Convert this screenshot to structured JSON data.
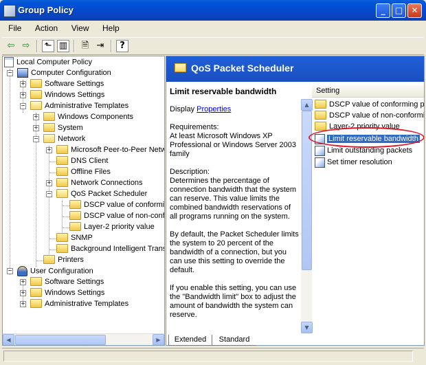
{
  "window": {
    "title": "Group Policy",
    "min_label": "_",
    "max_label": "□",
    "close_label": "✕"
  },
  "menu": [
    "File",
    "Action",
    "View",
    "Help"
  ],
  "toolbar": {
    "back": "⇦",
    "forward": "⇨",
    "up": "⬑",
    "tree": "▥",
    "properties": "🗎",
    "export": "⇥",
    "help": "?"
  },
  "tree": {
    "root": "Local Computer Policy",
    "computer_config": "Computer Configuration",
    "software_settings": "Software Settings",
    "windows_settings": "Windows Settings",
    "admin_templates": "Administrative Templates",
    "windows_components": "Windows Components",
    "system": "System",
    "network": "Network",
    "peer": "Microsoft Peer-to-Peer Netw",
    "dns": "DNS Client",
    "offline": "Offline Files",
    "netconn": "Network Connections",
    "qos": "QoS Packet Scheduler",
    "dscp1": "DSCP value of conformin",
    "dscp2": "DSCP value of non-conf",
    "layer2": "Layer-2 priority value",
    "snmp": "SNMP",
    "bits": "Background Intelligent Trans",
    "printers": "Printers",
    "user_config": "User Configuration",
    "u_software": "Software Settings",
    "u_windows": "Windows Settings",
    "u_admin": "Administrative Templates"
  },
  "details": {
    "header": "QoS Packet Scheduler",
    "title": "Limit reservable bandwidth",
    "display": "Display",
    "properties_link": "Properties",
    "requirements": "Requirements:\nAt least Microsoft Windows XP Professional or Windows Server 2003 family",
    "description": "Description:\nDetermines the percentage of connection bandwidth that the system can reserve. This value limits the combined bandwidth reservations of all programs running on the system.",
    "default": "By default, the Packet Scheduler limits the system to 20 percent of the bandwidth of a connection, but you can use this setting to override the default.",
    "enable": "If you enable this setting, you can use the \"Bandwidth limit\" box to adjust the amount of bandwidth the system can reserve."
  },
  "settings": {
    "column_header": "Setting",
    "items": [
      "DSCP value of conforming pa",
      "DSCP value of non-conformin",
      "Layer-2 priority value",
      "Limit reservable bandwidth",
      "Limit outstanding packets",
      "Set timer resolution"
    ],
    "selected_index": 3
  },
  "tabs": {
    "extended": "Extended",
    "standard": "Standard"
  }
}
